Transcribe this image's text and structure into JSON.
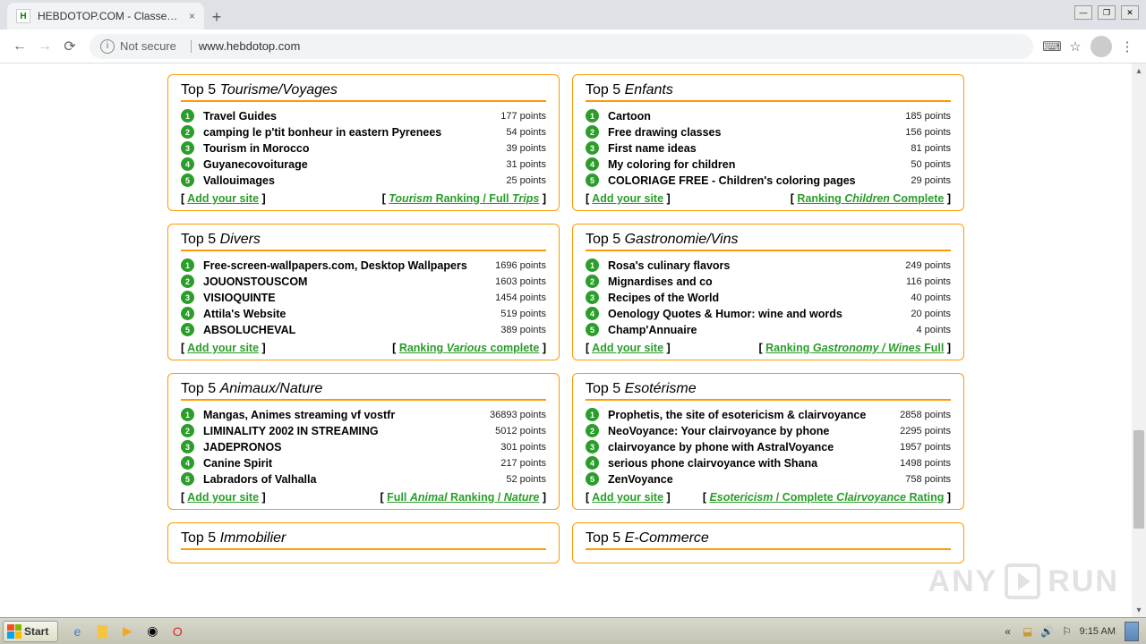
{
  "browser": {
    "tab_title": "HEBDOTOP.COM - Classement de sit",
    "not_secure": "Not secure",
    "url": "www.hebdotop.com"
  },
  "boxes": [
    {
      "title_prefix": "Top 5 ",
      "title_italic": "Tourisme/Voyages",
      "items": [
        {
          "n": "1",
          "name": "Travel Guides",
          "pts": "177 points"
        },
        {
          "n": "2",
          "name": "camping le p'tit bonheur in eastern Pyrenees",
          "pts": "54 points"
        },
        {
          "n": "3",
          "name": "Tourism in Morocco",
          "pts": "39 points"
        },
        {
          "n": "4",
          "name": "Guyanecovoiturage",
          "pts": "31 points"
        },
        {
          "n": "5",
          "name": "Vallouimages",
          "pts": "25 points"
        }
      ],
      "add": "Add your site",
      "ranking_parts": [
        "",
        "Tourism",
        " Ranking / Full ",
        "Trips",
        ""
      ]
    },
    {
      "title_prefix": "Top 5 ",
      "title_italic": "Enfants",
      "items": [
        {
          "n": "1",
          "name": "Cartoon",
          "pts": "185 points"
        },
        {
          "n": "2",
          "name": "Free drawing classes",
          "pts": "156 points"
        },
        {
          "n": "3",
          "name": "First name ideas",
          "pts": "81 points"
        },
        {
          "n": "4",
          "name": "My coloring for children",
          "pts": "50 points"
        },
        {
          "n": "5",
          "name": "COLORIAGE FREE - Children's coloring pages",
          "pts": "29 points"
        }
      ],
      "add": "Add your site",
      "ranking_parts": [
        "Ranking ",
        "Children",
        " Complete",
        "",
        ""
      ]
    },
    {
      "title_prefix": "Top 5 ",
      "title_italic": "Divers",
      "items": [
        {
          "n": "1",
          "name": "Free-screen-wallpapers.com, Desktop Wallpapers",
          "pts": "1696 points"
        },
        {
          "n": "2",
          "name": "JOUONSTOUSCOM",
          "pts": "1603 points"
        },
        {
          "n": "3",
          "name": "VISIOQUINTE",
          "pts": "1454 points"
        },
        {
          "n": "4",
          "name": "Attila's Website",
          "pts": "519 points"
        },
        {
          "n": "5",
          "name": "ABSOLUCHEVAL",
          "pts": "389 points"
        }
      ],
      "add": "Add your site",
      "ranking_parts": [
        "Ranking ",
        "Various",
        " complete",
        "",
        ""
      ]
    },
    {
      "title_prefix": "Top 5 ",
      "title_italic": "Gastronomie/Vins",
      "items": [
        {
          "n": "1",
          "name": "Rosa's culinary flavors",
          "pts": "249 points"
        },
        {
          "n": "2",
          "name": "Mignardises and co",
          "pts": "116 points"
        },
        {
          "n": "3",
          "name": "Recipes of the World",
          "pts": "40 points"
        },
        {
          "n": "4",
          "name": "Oenology Quotes & Humor: wine and words",
          "pts": "20 points"
        },
        {
          "n": "5",
          "name": "Champ'Annuaire",
          "pts": "4 points"
        }
      ],
      "add": "Add your site",
      "ranking_parts": [
        "Ranking ",
        "Gastronomy / Wines",
        " Full",
        "",
        ""
      ]
    },
    {
      "title_prefix": "Top 5 ",
      "title_italic": "Animaux/Nature",
      "items": [
        {
          "n": "1",
          "name": "Mangas, Animes streaming vf vostfr",
          "pts": "36893 points"
        },
        {
          "n": "2",
          "name": "LIMINALITY 2002 IN STREAMING",
          "pts": "5012 points"
        },
        {
          "n": "3",
          "name": "JADEPRONOS",
          "pts": "301 points"
        },
        {
          "n": "4",
          "name": "Canine Spirit",
          "pts": "217 points"
        },
        {
          "n": "5",
          "name": "Labradors of Valhalla",
          "pts": "52 points"
        }
      ],
      "add": "Add your site",
      "ranking_parts": [
        "Full ",
        "Animal",
        " Ranking / ",
        "Nature",
        ""
      ]
    },
    {
      "title_prefix": "Top 5 ",
      "title_italic": "Esotérisme",
      "items": [
        {
          "n": "1",
          "name": "Prophetis, the site of esotericism & clairvoyance",
          "pts": "2858 points"
        },
        {
          "n": "2",
          "name": "NeoVoyance: Your clairvoyance by phone",
          "pts": "2295 points"
        },
        {
          "n": "3",
          "name": "clairvoyance by phone with AstralVoyance",
          "pts": "1957 points"
        },
        {
          "n": "4",
          "name": "serious phone clairvoyance with Shana",
          "pts": "1498 points"
        },
        {
          "n": "5",
          "name": "ZenVoyance",
          "pts": "758 points"
        }
      ],
      "add": "Add your site",
      "ranking_parts": [
        "",
        "Esotericism",
        " / Complete ",
        "Clairvoyance",
        " Rating"
      ]
    },
    {
      "title_prefix": "Top 5 ",
      "title_italic": "Immobilier",
      "items": [],
      "add": "",
      "ranking_parts": [
        "",
        "",
        "",
        "",
        ""
      ]
    },
    {
      "title_prefix": "Top 5 ",
      "title_italic": "E-Commerce",
      "items": [],
      "add": "",
      "ranking_parts": [
        "",
        "",
        "",
        "",
        ""
      ]
    }
  ],
  "taskbar": {
    "start": "Start",
    "time": "9:15 AM"
  },
  "watermark": {
    "left": "ANY",
    "right": "RUN"
  }
}
